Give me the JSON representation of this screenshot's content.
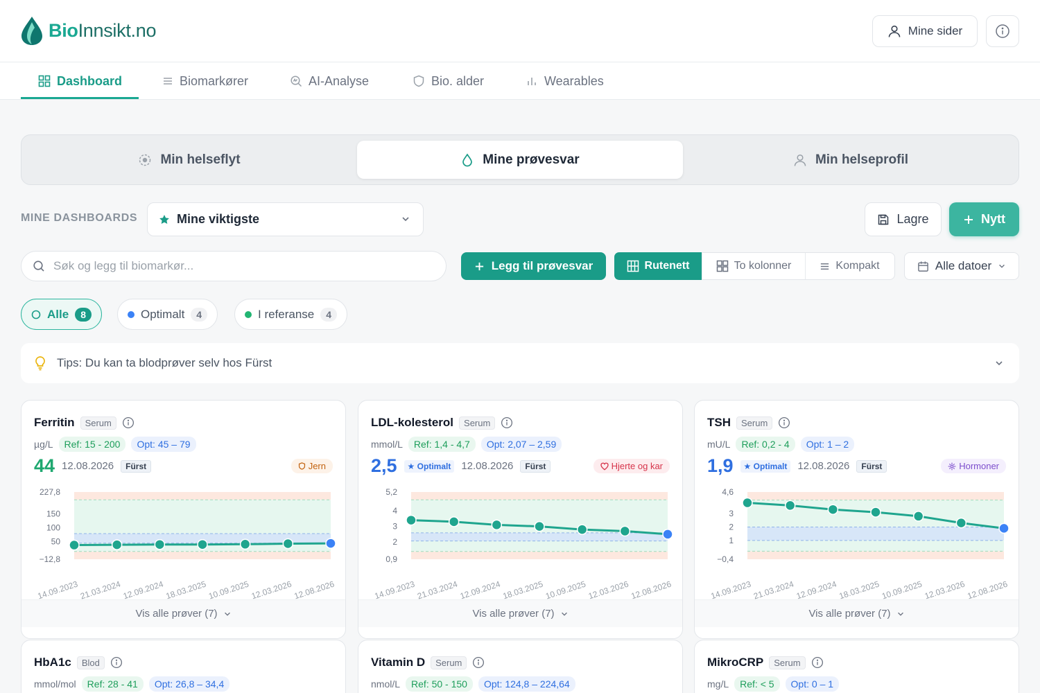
{
  "app": {
    "logo_bold": "Bio",
    "logo_rest": "Innsikt.no",
    "mine_sider": "Mine sider"
  },
  "nav": [
    {
      "label": "Dashboard",
      "icon": "grid-icon",
      "active": true
    },
    {
      "label": "Biomarkører",
      "icon": "list-icon"
    },
    {
      "label": "AI-Analyse",
      "icon": "ai-search-icon"
    },
    {
      "label": "Bio. alder",
      "icon": "shield-icon"
    },
    {
      "label": "Wearables",
      "icon": "bar-chart-icon"
    }
  ],
  "segments": [
    {
      "label": "Min helseflyt",
      "icon": "flow-icon"
    },
    {
      "label": "Mine prøvesvar",
      "icon": "drop-icon",
      "active": true
    },
    {
      "label": "Min helseprofil",
      "icon": "user-icon"
    }
  ],
  "dashboards": {
    "label": "MINE DASHBOARDS",
    "selected": "Mine viktigste",
    "save": "Lagre",
    "new": "Nytt"
  },
  "toolbar": {
    "search_placeholder": "Søk og legg til biomarkør...",
    "add_result": "Legg til prøvesvar",
    "views": [
      "Rutenett",
      "To kolonner",
      "Kompakt"
    ],
    "dates": "Alle datoer"
  },
  "filters": [
    {
      "label": "Alle",
      "count": "8",
      "active": true
    },
    {
      "label": "Optimalt",
      "count": "4",
      "color": "#3b82f6"
    },
    {
      "label": "I referanse",
      "count": "4",
      "color": "#22b573"
    }
  ],
  "tips": "Tips: Du kan ta blodprøver selv hos Fürst",
  "colors": {
    "brand": "#1aa892",
    "optimal": "#3b82f6",
    "in_range": "#22b573",
    "line": "#1fa58e"
  },
  "cards": [
    {
      "name": "Ferritin",
      "sample": "Serum",
      "unit": "µg/L",
      "ref": "Ref: 15 - 200",
      "opt": "Opt: 45 – 79",
      "value": "44",
      "value_color": "#1fa870",
      "status": "",
      "date": "12.08.2026",
      "lab": "Fürst",
      "category": "Jern",
      "category_bg": "#fdf2e8",
      "category_color": "#c2620f",
      "footer": "Vis alle prøver (7)",
      "chart_data": {
        "type": "line",
        "ylim": [
          -12.8,
          227.8
        ],
        "yticks": [
          "227,8",
          "150",
          "100",
          "50",
          "−12,8"
        ],
        "ytick_values": [
          227.8,
          150,
          100,
          50,
          -12.8
        ],
        "ref_range": [
          15,
          200
        ],
        "opt_range": [
          45,
          79
        ],
        "x": [
          "14.09.2023",
          "21.03.2024",
          "12.09.2024",
          "18.03.2025",
          "10.09.2025",
          "12.03.2026",
          "12.08.2026"
        ],
        "values": [
          38,
          39,
          40,
          40,
          41,
          43,
          44
        ]
      }
    },
    {
      "name": "LDL-kolesterol",
      "sample": "Serum",
      "unit": "mmol/L",
      "ref": "Ref: 1,4 - 4,7",
      "opt": "Opt: 2,07 – 2,59",
      "value": "2,5",
      "value_color": "#2f6fe0",
      "status": "Optimalt",
      "date": "12.08.2026",
      "lab": "Fürst",
      "category": "Hjerte og kar",
      "category_bg": "#fdecee",
      "category_color": "#d6334a",
      "footer": "Vis alle prøver (7)",
      "chart_data": {
        "type": "line",
        "ylim": [
          0.9,
          5.2
        ],
        "yticks": [
          "5,2",
          "4",
          "3",
          "2",
          "0,9"
        ],
        "ytick_values": [
          5.2,
          4,
          3,
          2,
          0.9
        ],
        "ref_range": [
          1.4,
          4.7
        ],
        "opt_range": [
          2.07,
          2.59
        ],
        "x": [
          "14.09.2023",
          "21.03.2024",
          "12.09.2024",
          "18.03.2025",
          "10.09.2025",
          "12.03.2026",
          "12.08.2026"
        ],
        "values": [
          3.4,
          3.3,
          3.1,
          3.0,
          2.8,
          2.7,
          2.5
        ]
      }
    },
    {
      "name": "TSH",
      "sample": "Serum",
      "unit": "mU/L",
      "ref": "Ref: 0,2 - 4",
      "opt": "Opt: 1 – 2",
      "value": "1,9",
      "value_color": "#2f6fe0",
      "status": "Optimalt",
      "date": "12.08.2026",
      "lab": "Fürst",
      "category": "Hormoner",
      "category_bg": "#f4effd",
      "category_color": "#7c4dcc",
      "footer": "Vis alle prøver (7)",
      "chart_data": {
        "type": "line",
        "ylim": [
          -0.4,
          4.6
        ],
        "yticks": [
          "4,6",
          "3",
          "2",
          "1",
          "−0,4"
        ],
        "ytick_values": [
          4.6,
          3,
          2,
          1,
          -0.4
        ],
        "ref_range": [
          0.2,
          4
        ],
        "opt_range": [
          1,
          2
        ],
        "x": [
          "14.09.2023",
          "21.03.2024",
          "12.09.2024",
          "18.03.2025",
          "10.09.2025",
          "12.03.2026",
          "12.08.2026"
        ],
        "values": [
          3.8,
          3.6,
          3.3,
          3.1,
          2.8,
          2.3,
          1.9
        ]
      }
    },
    {
      "name": "HbA1c",
      "sample": "Blod",
      "unit": "mmol/mol",
      "ref": "Ref: 28 - 41",
      "opt": "Opt: 26,8 – 34,4"
    },
    {
      "name": "Vitamin D",
      "sample": "Serum",
      "unit": "nmol/L",
      "ref": "Ref: 50 - 150",
      "opt": "Opt: 124,8 – 224,64"
    },
    {
      "name": "MikroCRP",
      "sample": "Serum",
      "unit": "mg/L",
      "ref": "Ref: < 5",
      "opt": "Opt: 0 – 1"
    }
  ]
}
